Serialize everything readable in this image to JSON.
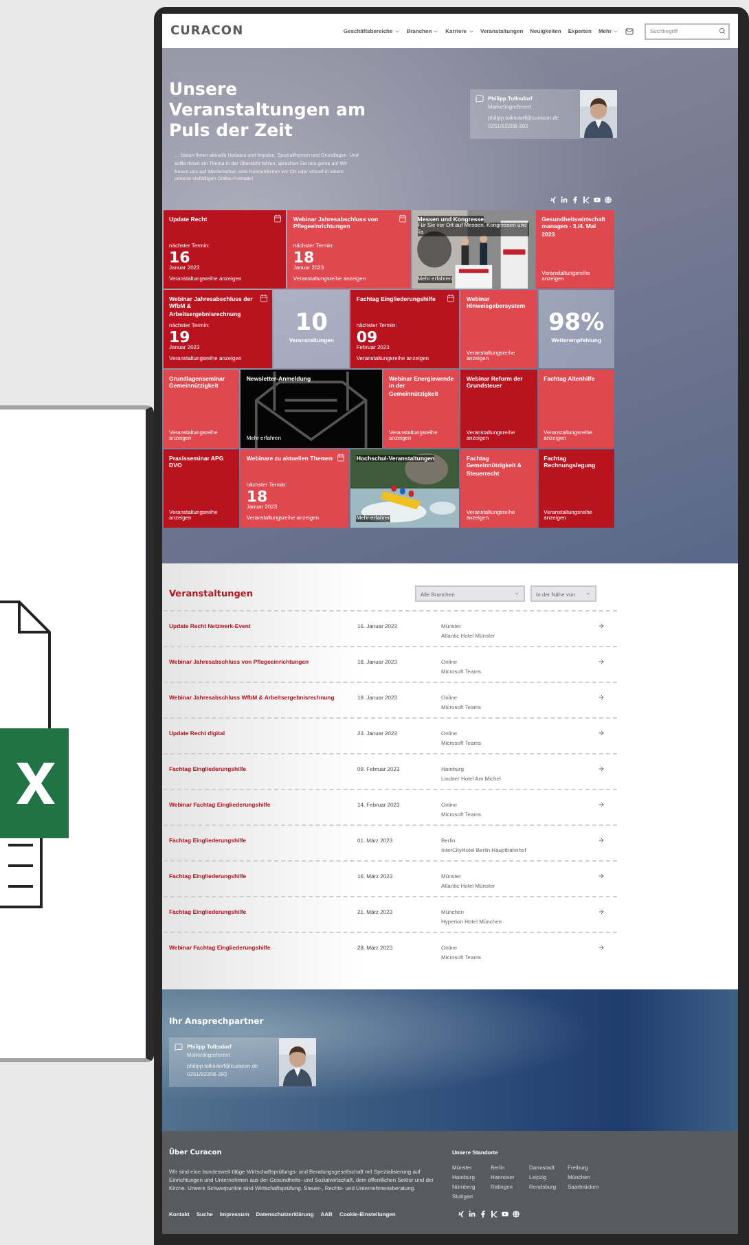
{
  "header": {
    "logo": "CURACON",
    "nav": [
      {
        "label": "Geschäftsbereiche",
        "dropdown": true
      },
      {
        "label": "Branchen",
        "dropdown": true
      },
      {
        "label": "Karriere",
        "dropdown": true
      },
      {
        "label": "Veranstaltungen",
        "dropdown": false
      },
      {
        "label": "Neuigkeiten",
        "dropdown": false
      },
      {
        "label": "Experten",
        "dropdown": false
      },
      {
        "label": "Mehr",
        "dropdown": true
      }
    ],
    "search": {
      "placeholder": "Suchbegriff"
    }
  },
  "hero": {
    "title": "Unsere Veranstaltungen am Puls der Zeit",
    "text": "… bieten Ihnen aktuelle Updates und Impulse, Spezialthemen und Grundlagen. Und sollte Ihnen ein Thema in der Übersicht fehlen, sprechen Sie uns gerne an! Wir freuen uns auf Wiedersehen oder Kennenlernen vor Ort oder virtuell in einem unserer vielfältigen Online-Formate!",
    "contact": {
      "name": "Philipp Tolksdorf",
      "role": "Marketingreferent",
      "email": "philipp.tolksdorf@curacon.de",
      "phone": "0251/92208-393"
    },
    "tile_rows": [
      [
        {
          "kind": "event",
          "title": "Update Recht",
          "color": "#b8131f",
          "next_label": "nächster Termin:",
          "day": "16",
          "month": "Januar 2023",
          "link": "Veranstaltungsreihe anzeigen"
        },
        {
          "kind": "event",
          "title": "Webinar Jahresabschluss von Pflegeeinrichtungen",
          "color": "#e0484f",
          "next_label": "nächster Termin:",
          "day": "18",
          "month": "Januar 2023",
          "link": "Veranstaltungsreihe anzeigen"
        },
        {
          "title": "Messen und Kongresse",
          "subtitle": "Für Sie vor Ort auf Messen, Kongressen und Ta",
          "link": "Mehr erfahren"
        },
        {
          "kind": "series",
          "title": "Gesundheitswirtschaft managen - 3./4. Mai 2023",
          "color": "#e0484f",
          "link": "Veranstaltungsreihe anzeigen"
        }
      ],
      [
        {
          "kind": "event",
          "title": "Webinar Jahresabschluss der WfbM & Arbeitsergebnisrechnung",
          "color": "#b8131f",
          "next_label": "nächster Termin:",
          "day": "19",
          "month": "Januar 2023",
          "link": "Veranstaltungsreihe anzeigen"
        },
        {
          "kind": "stat",
          "value": "10",
          "label": "Veranstaltungen"
        },
        {
          "kind": "event",
          "title": "Fachtag Eingliederungshilfe",
          "color": "#b8131f",
          "next_label": "nächster Termin:",
          "day": "09",
          "month": "Februar 2023",
          "link": "Veranstaltungsreihe anzeigen"
        },
        {
          "kind": "series",
          "title": "Webinar Hinweisgebersystem",
          "color": "#e0484f",
          "link": "Veranstaltungsreihe anzeigen"
        },
        {
          "kind": "stat",
          "value": "98%",
          "label": "Weiterempfehlung"
        }
      ],
      [
        {
          "kind": "series",
          "title": "Grundlagenseminar Gemeinnützigkeit",
          "color": "#e0484f",
          "link": "Veranstaltungsreihe anzeigen"
        },
        {
          "kind": "newsletter",
          "title": "Newsletter-Anmeldung",
          "link": "Mehr erfahren"
        },
        {
          "kind": "series",
          "title": "Webinar Energiewende in der Gemeinnützigkeit",
          "color": "#e0484f",
          "link": "Veranstaltungsreihe anzeigen"
        },
        {
          "kind": "series",
          "title": "Webinar Reform der Grundsteuer",
          "color": "#b8131f",
          "link": "Veranstaltungsreihe anzeigen"
        },
        {
          "kind": "series",
          "title": "Fachtag Altenhilfe",
          "color": "#e0484f",
          "link": "Veranstaltungsreihe anzeigen"
        }
      ],
      [
        {
          "kind": "series",
          "title": "Praxisseminar APG DVO",
          "color": "#b8131f",
          "link": "Veranstaltungsreihe anzeigen"
        },
        {
          "kind": "event",
          "title": "Webinare zu aktuellen Themen",
          "color": "#e0484f",
          "next_label": "nächster Termin:",
          "day": "18",
          "month": "Januar 2023",
          "link": "Veranstaltungsreihe anzeigen"
        },
        {
          "title": "Hochschul-Veranstaltungen",
          "link": "Mehr erfahren"
        },
        {
          "kind": "series",
          "title": "Fachtag Gemeinnützigkeit & Steuerrecht",
          "color": "#e0484f",
          "link": "Veranstaltungsreihe anzeigen"
        },
        {
          "kind": "series",
          "title": "Fachtag Rechnungslegung",
          "color": "#b8131f",
          "link": "Veranstaltungsreihe anzeigen"
        }
      ]
    ]
  },
  "events": {
    "title": "Veranstaltungen",
    "filters": [
      "Alle Branchen",
      "In der Nähe von"
    ],
    "rows": [
      {
        "title": "Update Recht Netzwerk-Event",
        "date": "16. Januar 2023",
        "city": "Münster",
        "venue": "Atlantic Hotel Münster"
      },
      {
        "title": "Webinar Jahresabschluss von Pflegeeinrichtungen",
        "date": "18. Januar 2023",
        "city": "Online",
        "venue": "Microsoft Teams"
      },
      {
        "title": "Webinar Jahresabschluss WfbM & Arbeitsergebnisrechnung",
        "date": "19. Januar 2023",
        "city": "Online",
        "venue": "Microsoft Teams"
      },
      {
        "title": "Update Recht digital",
        "date": "23. Januar 2023",
        "city": "Online",
        "venue": "Microsoft Teams"
      },
      {
        "title": "Fachtag Eingliederungshilfe",
        "date": "09. Februar 2023",
        "city": "Hamburg",
        "venue": "Lindner Hotel Am Michel"
      },
      {
        "title": "Webinar Fachtag Eingliederungshilfe",
        "date": "14. Februar 2023",
        "city": "Online",
        "venue": "Microsoft Teams"
      },
      {
        "title": "Fachtag Eingliederungshilfe",
        "date": "01. März 2023",
        "city": "Berlin",
        "venue": "InterCityHotel Berlin Hauptbahnhof"
      },
      {
        "title": "Fachtag Eingliederungshilfe",
        "date": "16. März 2023",
        "city": "Münster",
        "venue": "Atlantic Hotel Münster"
      },
      {
        "title": "Fachtag Eingliederungshilfe",
        "date": "21. März 2023",
        "city": "München",
        "venue": "Hyperion Hotel München"
      },
      {
        "title": "Webinar Fachtag Eingliederungshilfe",
        "date": "28. März 2023",
        "city": "Online",
        "venue": "Microsoft Teams"
      }
    ]
  },
  "contact_section": {
    "title": "Ihr Ansprechpartner",
    "contact": {
      "name": "Philipp Tolksdorf",
      "role": "Marketingreferent",
      "email": "philipp.tolksdorf@curacon.de",
      "phone": "0251/92208-393"
    }
  },
  "footer": {
    "title": "Über Curacon",
    "text": "Wir sind eine bundesweit tätige Wirtschaftsprüfungs- und Beratungsgesellschaft mit Spezialisierung auf Einrichtungen und Unternehmen aus der Gesundheits- und Sozialwirtschaft, dem öffentlichen Sektor und der Kirche. Unsere Schwerpunkte sind Wirtschaftsprüfung, Steuer-, Rechts- und Unternehmensberatung.",
    "locations_title": "Unsere Standorte",
    "locations": [
      "Münster",
      "Berlin",
      "Darmstadt",
      "Freiburg",
      "Hamburg",
      "Hannover",
      "Leipzig",
      "München",
      "Nürnberg",
      "Ratingen",
      "Rendsburg",
      "Saarbrücken",
      "Stuttgart"
    ],
    "links": [
      "Kontakt",
      "Suche",
      "Impressum",
      "Datenschutzerklärung",
      "AAB",
      "Cookie-Einstellungen"
    ]
  }
}
